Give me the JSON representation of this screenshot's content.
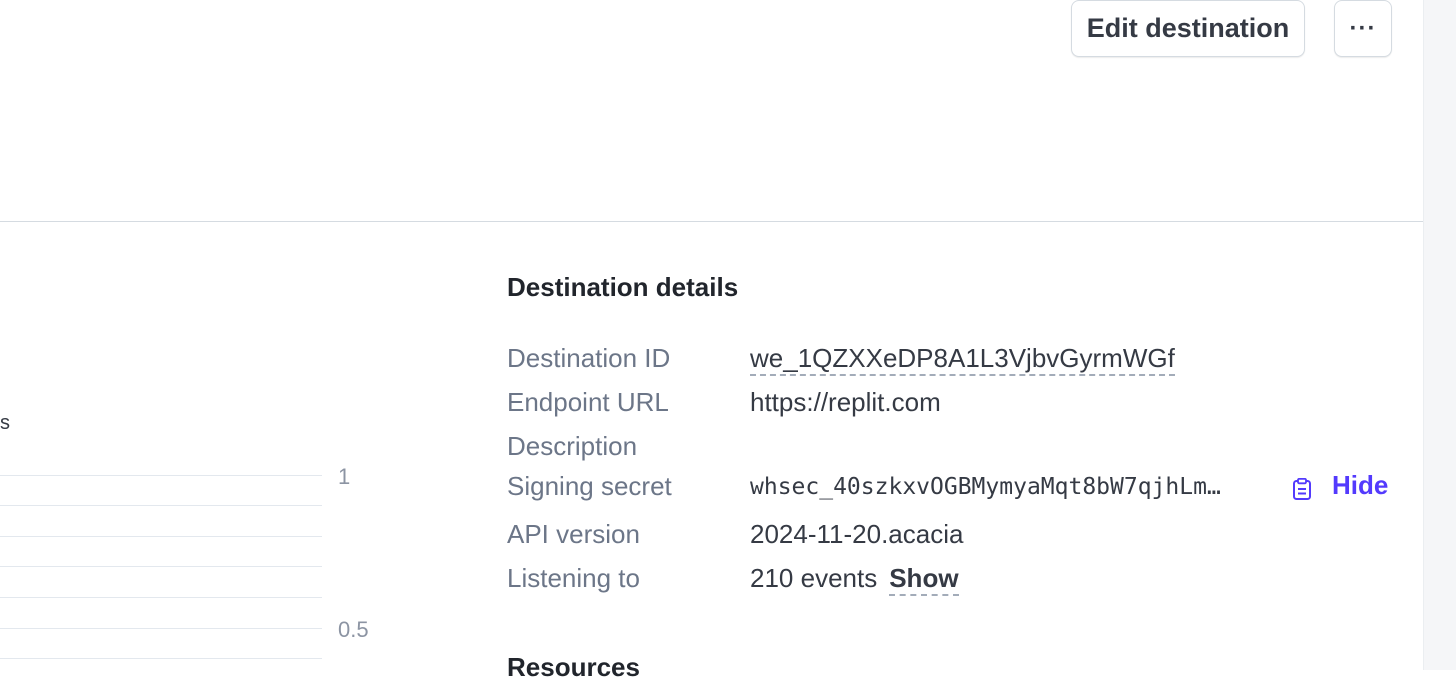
{
  "header": {
    "edit_label": "Edit destination",
    "more_label": "···"
  },
  "chart": {
    "legend_fragment": "s",
    "ticks": [
      "1",
      "0.5"
    ]
  },
  "details": {
    "title": "Destination details",
    "rows": {
      "destination_id": {
        "label": "Destination ID",
        "value": "we_1QZXXeDP8A1L3VjbvGyrmWGf"
      },
      "endpoint_url": {
        "label": "Endpoint URL",
        "value": "https://replit.com"
      },
      "description": {
        "label": "Description",
        "value": ""
      },
      "signing_secret": {
        "label": "Signing secret",
        "value": "whsec_40szkxvOGBMymyaMqt8bW7qjhLm…",
        "action": "Hide"
      },
      "api_version": {
        "label": "API version",
        "value": "2024-11-20.acacia"
      },
      "listening_to": {
        "label": "Listening to",
        "value": "210 events",
        "action": "Show"
      }
    }
  },
  "resources": {
    "title": "Resources"
  },
  "icons": {
    "copy": "clipboard-icon"
  },
  "colors": {
    "link": "#533afd",
    "divider": "#d5dbe1",
    "label": "#6c7688"
  }
}
